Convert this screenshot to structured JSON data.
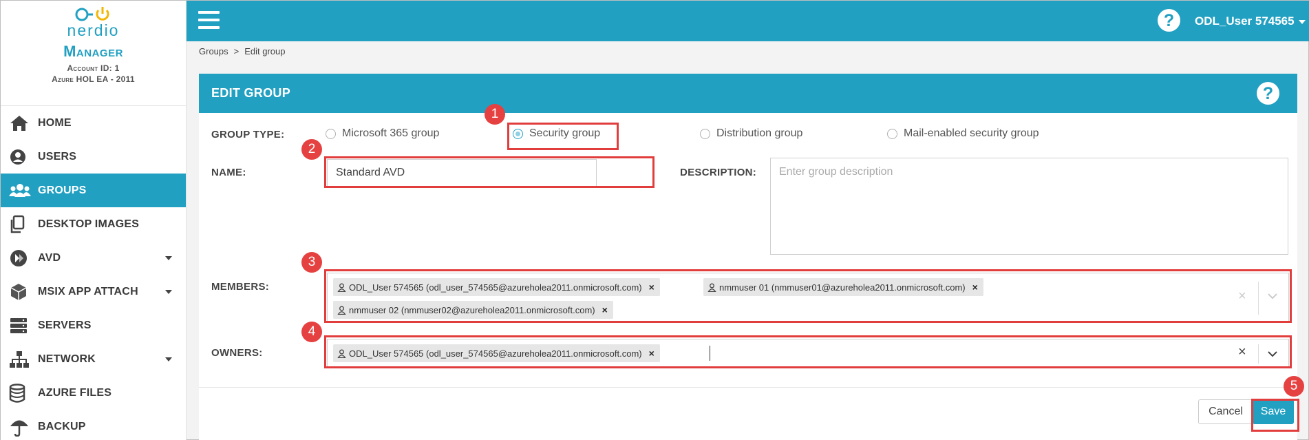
{
  "brand": {
    "logo_word": "nerdio",
    "product": "Manager",
    "account_line": "Account ID: 1",
    "org_line": "Azure HOL EA - 2011"
  },
  "sidebar": {
    "items": [
      {
        "label": "HOME",
        "icon": "home-icon",
        "active": false,
        "has_caret": false
      },
      {
        "label": "USERS",
        "icon": "user-circle-icon",
        "active": false,
        "has_caret": false
      },
      {
        "label": "GROUPS",
        "icon": "users-group-icon",
        "active": true,
        "has_caret": false
      },
      {
        "label": "DESKTOP IMAGES",
        "icon": "copy-icon",
        "active": false,
        "has_caret": false
      },
      {
        "label": "AVD",
        "icon": "avd-icon",
        "active": false,
        "has_caret": true
      },
      {
        "label": "MSIX APP ATTACH",
        "icon": "box-icon",
        "active": false,
        "has_caret": true
      },
      {
        "label": "SERVERS",
        "icon": "server-icon",
        "active": false,
        "has_caret": false
      },
      {
        "label": "NETWORK",
        "icon": "network-icon",
        "active": false,
        "has_caret": true
      },
      {
        "label": "AZURE FILES",
        "icon": "database-icon",
        "active": false,
        "has_caret": false
      },
      {
        "label": "BACKUP",
        "icon": "umbrella-icon",
        "active": false,
        "has_caret": false
      }
    ]
  },
  "topbar": {
    "help_glyph": "?",
    "user_label": "ODL_User 574565"
  },
  "breadcrumb": {
    "parent": "Groups",
    "separator": ">",
    "current": "Edit group"
  },
  "form": {
    "title": "EDIT GROUP",
    "help_glyph": "?",
    "group_type_label": "GROUP TYPE:",
    "group_types": [
      {
        "label": "Microsoft 365 group",
        "checked": false
      },
      {
        "label": "Security group",
        "checked": true
      },
      {
        "label": "Distribution group",
        "checked": false
      },
      {
        "label": "Mail-enabled security group",
        "checked": false
      }
    ],
    "name_label": "NAME:",
    "name_value": "Standard AVD",
    "description_label": "DESCRIPTION:",
    "description_placeholder": "Enter group description",
    "members_label": "MEMBERS:",
    "members": [
      "ODL_User 574565 (odl_user_574565@azureholea2011.onmicrosoft.com)",
      "nmmuser 01 (nmmuser01@azureholea2011.onmicrosoft.com)",
      "nmmuser 02 (nmmuser02@azureholea2011.onmicrosoft.com)"
    ],
    "owners_label": "OWNERS:",
    "owners": [
      "ODL_User 574565 (odl_user_574565@azureholea2011.onmicrosoft.com)"
    ],
    "tag_remove_glyph": "×",
    "clear_glyph": "×",
    "cancel_label": "Cancel",
    "save_label": "Save"
  },
  "annotations": [
    "1",
    "2",
    "3",
    "4",
    "5"
  ],
  "colors": {
    "brand": "#21a0c2",
    "highlight": "#e23d3d",
    "badge": "#e64141"
  }
}
